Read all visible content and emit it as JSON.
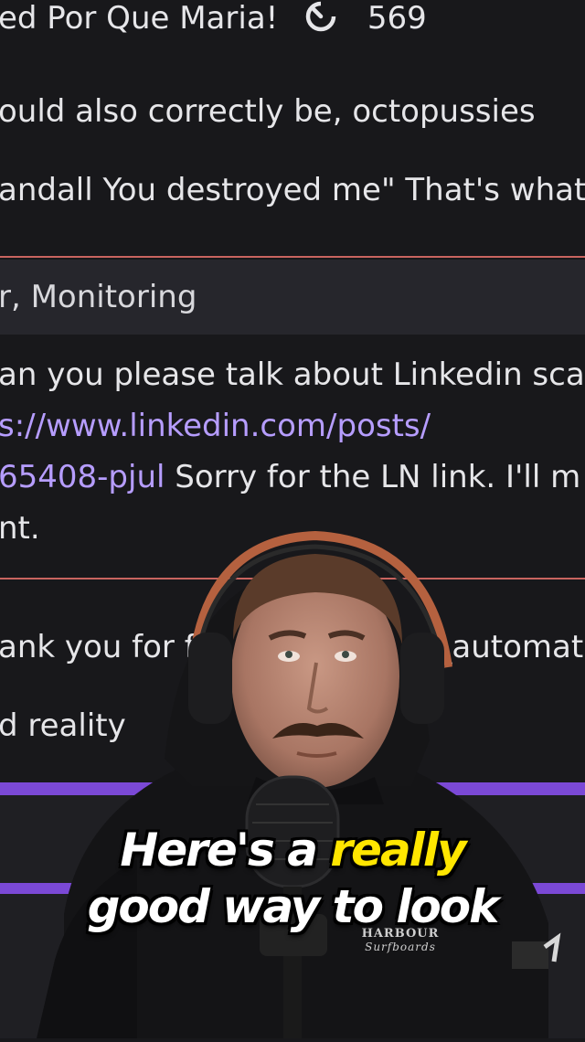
{
  "chat": {
    "top_line": {
      "text": "ed Por Que Maria!",
      "icon": "timer-icon",
      "count": "569"
    },
    "messages": [
      {
        "text": "ould also correctly be, octopussies"
      },
      {
        "text": "andall You destroyed me\" That's what"
      }
    ],
    "section_header": "r, Monitoring",
    "message_linkedin": {
      "line1": "an you please talk about Linkedin sca",
      "line2_link": "s://www.linkedin.com/posts/",
      "line3_link": "65408-pjul",
      "line3_text": " Sorry for the LN link. I'll m",
      "line4": "nt."
    },
    "message_thanks": {
      "line1": "ank you for fo",
      "line1_suffix": "e_automata",
      "line2": "d reality"
    }
  },
  "overlay": {
    "caption_line1_pre": "Here's a ",
    "caption_line1_highlight": "really",
    "caption_line2": "good way to look",
    "hoodie_text": "HARBOUR",
    "hoodie_script": "Surfboards"
  },
  "colors": {
    "background": "#18181b",
    "link": "#b69dff",
    "divider": "#c8645f",
    "accent_purple": "#7b49d6",
    "caption_highlight": "#ffe600"
  }
}
